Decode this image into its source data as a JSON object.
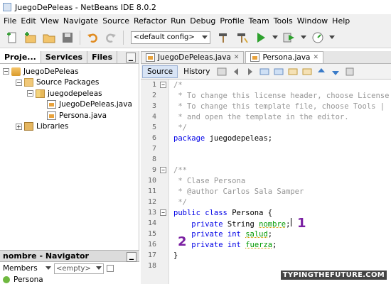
{
  "window": {
    "title": "JuegoDePeleas - NetBeans IDE 8.0.2"
  },
  "menubar": {
    "items": [
      "File",
      "Edit",
      "View",
      "Navigate",
      "Source",
      "Refactor",
      "Run",
      "Debug",
      "Profile",
      "Team",
      "Tools",
      "Window",
      "Help"
    ]
  },
  "toolbar": {
    "config_value": "<default config>"
  },
  "projects_panel": {
    "tabs": [
      "Proje...",
      "Services",
      "Files"
    ],
    "tree": {
      "project": "JuegoDePeleas",
      "source_packages": "Source Packages",
      "package": "juegodepeleas",
      "files": [
        "JuegoDePeleas.java",
        "Persona.java"
      ],
      "libraries": "Libraries"
    }
  },
  "navigator": {
    "title": "nombre - Navigator",
    "filter_label": "Members",
    "filter_value": "<empty>",
    "item": "Persona"
  },
  "editor": {
    "tabs": [
      "JuegoDePeleas.java",
      "Persona.java"
    ],
    "active_tab": "Persona.java",
    "source_label": "Source",
    "history_label": "History",
    "lines": [
      "/*",
      " * To change this license header, choose License",
      " * To change this template file, choose Tools |",
      " * and open the template in the editor.",
      " */",
      "package juegodepeleas;",
      "",
      "",
      "/**",
      " * Clase Persona",
      " * @author Carlos Sala Samper",
      " */",
      "public class Persona {",
      "    private String nombre;",
      "    private int salud;",
      "    private int fuerza;",
      "}",
      ""
    ]
  },
  "annotations": {
    "badge_1": "1",
    "badge_2": "2",
    "watermark": "TYPINGTHEFUTURE.COM"
  }
}
